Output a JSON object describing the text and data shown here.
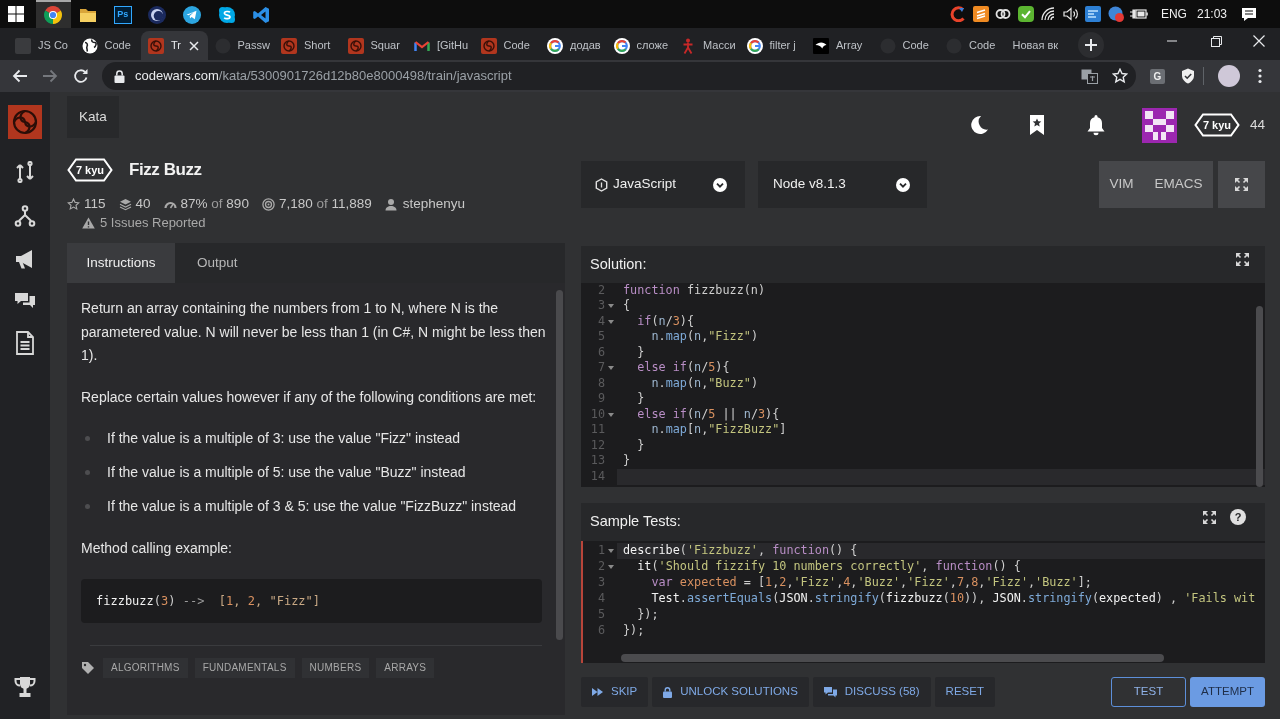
{
  "taskbar": {
    "apps": [
      {
        "kind": "chrome",
        "active": true
      },
      {
        "kind": "folder",
        "active": false
      },
      {
        "kind": "photoshop",
        "label": "Ps",
        "active": false
      },
      {
        "kind": "sphere",
        "active": false
      },
      {
        "kind": "telegram",
        "active": false
      },
      {
        "kind": "skype",
        "active": false
      },
      {
        "kind": "vscode",
        "active": false
      }
    ],
    "tray": [
      {
        "kind": "cleaner"
      },
      {
        "kind": "sublime"
      },
      {
        "kind": "cloud"
      },
      {
        "kind": "check"
      },
      {
        "kind": "wifi"
      },
      {
        "kind": "volume"
      },
      {
        "kind": "window"
      },
      {
        "kind": "badge"
      },
      {
        "kind": "battery"
      }
    ],
    "language": "ENG",
    "time": "21:03"
  },
  "browser_tabs": [
    {
      "title": "JS Co",
      "kind": "tile",
      "selected": false
    },
    {
      "title": "Code",
      "kind": "globe",
      "selected": false
    },
    {
      "title": "Tr",
      "kind": "codewars",
      "selected": true
    },
    {
      "title": "Passw",
      "kind": "github",
      "selected": false
    },
    {
      "title": "Short",
      "kind": "codewars",
      "selected": false
    },
    {
      "title": "Squar",
      "kind": "codewars",
      "selected": false
    },
    {
      "title": "[GitHu",
      "kind": "gmail",
      "selected": false
    },
    {
      "title": "Code",
      "kind": "codewars",
      "selected": false
    },
    {
      "title": "додав",
      "kind": "google",
      "selected": false
    },
    {
      "title": "сложе",
      "kind": "google",
      "selected": false
    },
    {
      "title": "Масси",
      "kind": "figure",
      "selected": false
    },
    {
      "title": "filter j",
      "kind": "google",
      "selected": false
    },
    {
      "title": "Array",
      "kind": "bird",
      "selected": false
    },
    {
      "title": "Code",
      "kind": "github",
      "selected": false
    },
    {
      "title": "Code",
      "kind": "github",
      "selected": false
    },
    {
      "title": "Новая вк",
      "kind": "blank",
      "selected": false
    }
  ],
  "address_bar": {
    "host": "codewars.com",
    "path": "/kata/5300901726d12b80e8000498/train/javascript",
    "extension_label": "G"
  },
  "sidebar": {
    "items": [
      {
        "kind": "logo"
      },
      {
        "kind": "swap"
      },
      {
        "kind": "fork"
      },
      {
        "kind": "megaphone"
      },
      {
        "kind": "chat"
      },
      {
        "kind": "document"
      },
      {
        "kind": "trophy"
      }
    ]
  },
  "header": {
    "tab": "Kata",
    "user_rank": "7 kyu",
    "honor": "44"
  },
  "kata": {
    "rank": "7 kyu",
    "title": "Fizz Buzz",
    "stats": [
      {
        "kind": "stars",
        "value": "115"
      },
      {
        "kind": "collections",
        "value": "40"
      },
      {
        "kind": "satisfaction",
        "value": "87%",
        "of": "of",
        "total": "890"
      },
      {
        "kind": "completions",
        "value": "7,180",
        "of": "of",
        "total": "11,889"
      },
      {
        "kind": "author",
        "value": "stephenyu"
      }
    ],
    "issues": "5 Issues Reported"
  },
  "description_tabs": [
    {
      "label": "Instructions",
      "selected": true
    },
    {
      "label": "Output",
      "selected": false
    }
  ],
  "description": [
    {
      "kind": "paragraph",
      "text": "Return an array containing the numbers from 1 to N, where N is the parametered value. N will never be less than 1 (in C#, N might be less then 1)."
    },
    {
      "kind": "paragraph",
      "text": "Replace certain values however if any of the following conditions are met:"
    },
    {
      "kind": "list",
      "items": [
        "If the value is a multiple of 3: use the value \"Fizz\" instead",
        "If the value is a multiple of 5: use the value \"Buzz\" instead",
        "If the value is a multiple of 3 & 5: use the value \"FizzBuzz\" instead"
      ]
    },
    {
      "kind": "paragraph",
      "text": "Method calling example:"
    },
    {
      "kind": "code",
      "tokens": [
        {
          "kind": "bright",
          "text": "fizzbuzz"
        },
        {
          "kind": "plain",
          "text": "("
        },
        {
          "kind": "num",
          "text": "3"
        },
        {
          "kind": "plain",
          "text": ")"
        },
        {
          "kind": "dim",
          "text": " -->  "
        },
        {
          "kind": "lit",
          "text": "["
        },
        {
          "kind": "num",
          "text": "1"
        },
        {
          "kind": "lit",
          "text": ", "
        },
        {
          "kind": "num",
          "text": "2"
        },
        {
          "kind": "lit",
          "text": ", \"Fizz\"]"
        }
      ]
    }
  ],
  "tags": [
    "ALGORITHMS",
    "FUNDAMENTALS",
    "NUMBERS",
    "ARRAYS"
  ],
  "editor": {
    "language": "JavaScript",
    "version": "Node v8.1.3",
    "modes": [
      {
        "label": "VIM",
        "selected": false
      },
      {
        "label": "EMACS",
        "selected": false
      }
    ]
  },
  "solution": {
    "title": "Solution:",
    "lines": [
      {
        "number": "2",
        "fold": false,
        "active": false,
        "tokens": [
          {
            "kind": "kw",
            "text": "function"
          },
          {
            "kind": "plain",
            "text": " fizzbuzz(n)"
          }
        ]
      },
      {
        "number": "3",
        "fold": true,
        "active": false,
        "tokens": [
          {
            "kind": "plain",
            "text": "{"
          }
        ]
      },
      {
        "number": "4",
        "fold": true,
        "active": false,
        "tokens": [
          {
            "kind": "kw",
            "text": "  if"
          },
          {
            "kind": "plain",
            "text": "("
          },
          {
            "kind": "ident",
            "text": "n"
          },
          {
            "kind": "plain",
            "text": "/"
          },
          {
            "kind": "num",
            "text": "3"
          },
          {
            "kind": "plain",
            "text": "){"
          }
        ]
      },
      {
        "number": "5",
        "fold": false,
        "active": false,
        "tokens": [
          {
            "kind": "ident",
            "text": "    n"
          },
          {
            "kind": "plain",
            "text": "."
          },
          {
            "kind": "fn",
            "text": "map"
          },
          {
            "kind": "plain",
            "text": "("
          },
          {
            "kind": "ident",
            "text": "n"
          },
          {
            "kind": "plain",
            "text": ","
          },
          {
            "kind": "str",
            "text": "\"Fizz\""
          },
          {
            "kind": "plain",
            "text": ")"
          }
        ]
      },
      {
        "number": "6",
        "fold": false,
        "active": false,
        "tokens": [
          {
            "kind": "plain",
            "text": "  }"
          }
        ]
      },
      {
        "number": "7",
        "fold": true,
        "active": false,
        "tokens": [
          {
            "kind": "kw",
            "text": "  else if"
          },
          {
            "kind": "plain",
            "text": "("
          },
          {
            "kind": "ident",
            "text": "n"
          },
          {
            "kind": "plain",
            "text": "/"
          },
          {
            "kind": "num",
            "text": "5"
          },
          {
            "kind": "plain",
            "text": "){"
          }
        ]
      },
      {
        "number": "8",
        "fold": false,
        "active": false,
        "tokens": [
          {
            "kind": "ident",
            "text": "    n"
          },
          {
            "kind": "plain",
            "text": "."
          },
          {
            "kind": "fn",
            "text": "map"
          },
          {
            "kind": "plain",
            "text": "("
          },
          {
            "kind": "ident",
            "text": "n"
          },
          {
            "kind": "plain",
            "text": ","
          },
          {
            "kind": "str",
            "text": "\"Buzz\""
          },
          {
            "kind": "plain",
            "text": ")"
          }
        ]
      },
      {
        "number": "9",
        "fold": false,
        "active": false,
        "tokens": [
          {
            "kind": "plain",
            "text": "  }"
          }
        ]
      },
      {
        "number": "10",
        "fold": true,
        "active": false,
        "tokens": [
          {
            "kind": "kw",
            "text": "  else if"
          },
          {
            "kind": "plain",
            "text": "("
          },
          {
            "kind": "ident",
            "text": "n"
          },
          {
            "kind": "plain",
            "text": "/"
          },
          {
            "kind": "num",
            "text": "5"
          },
          {
            "kind": "plain",
            "text": " || "
          },
          {
            "kind": "ident",
            "text": "n"
          },
          {
            "kind": "plain",
            "text": "/"
          },
          {
            "kind": "num",
            "text": "3"
          },
          {
            "kind": "plain",
            "text": "){"
          }
        ]
      },
      {
        "number": "11",
        "fold": false,
        "active": false,
        "tokens": [
          {
            "kind": "ident",
            "text": "    n"
          },
          {
            "kind": "plain",
            "text": "."
          },
          {
            "kind": "fn",
            "text": "map"
          },
          {
            "kind": "plain",
            "text": "["
          },
          {
            "kind": "ident",
            "text": "n"
          },
          {
            "kind": "plain",
            "text": ","
          },
          {
            "kind": "str",
            "text": "\"FizzBuzz\""
          },
          {
            "kind": "plain",
            "text": "]"
          }
        ]
      },
      {
        "number": "12",
        "fold": false,
        "active": false,
        "tokens": [
          {
            "kind": "plain",
            "text": "  }"
          }
        ]
      },
      {
        "number": "13",
        "fold": false,
        "active": false,
        "tokens": [
          {
            "kind": "plain",
            "text": "}"
          }
        ]
      },
      {
        "number": "14",
        "fold": false,
        "active": true
      }
    ]
  },
  "sample_tests": {
    "title": "Sample Tests:",
    "help": "?",
    "lines": [
      {
        "number": "1",
        "fold": true,
        "active": true,
        "tokens": [
          {
            "kind": "bright",
            "text": "describe"
          },
          {
            "kind": "plain",
            "text": "("
          },
          {
            "kind": "str",
            "text": "'Fizzbuzz'"
          },
          {
            "kind": "plain",
            "text": ", "
          },
          {
            "kind": "kw",
            "text": "function"
          },
          {
            "kind": "plain",
            "text": "() {"
          }
        ]
      },
      {
        "number": "2",
        "fold": true,
        "active": false,
        "tokens": [
          {
            "kind": "bright",
            "text": "  it"
          },
          {
            "kind": "plain",
            "text": "("
          },
          {
            "kind": "str",
            "text": "'Should fizzify 10 numbers correctly'"
          },
          {
            "kind": "plain",
            "text": ", "
          },
          {
            "kind": "kw",
            "text": "function"
          },
          {
            "kind": "plain",
            "text": "() {"
          }
        ]
      },
      {
        "number": "3",
        "fold": false,
        "active": false,
        "tokens": [
          {
            "kind": "kw",
            "text": "    var "
          },
          {
            "kind": "var",
            "text": "expected"
          },
          {
            "kind": "plain",
            "text": " = ["
          },
          {
            "kind": "num",
            "text": "1"
          },
          {
            "kind": "plain",
            "text": ","
          },
          {
            "kind": "num",
            "text": "2"
          },
          {
            "kind": "plain",
            "text": ","
          },
          {
            "kind": "str",
            "text": "'Fizz'"
          },
          {
            "kind": "plain",
            "text": ","
          },
          {
            "kind": "num",
            "text": "4"
          },
          {
            "kind": "plain",
            "text": ","
          },
          {
            "kind": "str",
            "text": "'Buzz'"
          },
          {
            "kind": "plain",
            "text": ","
          },
          {
            "kind": "str",
            "text": "'Fizz'"
          },
          {
            "kind": "plain",
            "text": ","
          },
          {
            "kind": "num",
            "text": "7"
          },
          {
            "kind": "plain",
            "text": ","
          },
          {
            "kind": "num",
            "text": "8"
          },
          {
            "kind": "plain",
            "text": ","
          },
          {
            "kind": "str",
            "text": "'Fizz'"
          },
          {
            "kind": "plain",
            "text": ","
          },
          {
            "kind": "str",
            "text": "'Buzz'"
          },
          {
            "kind": "plain",
            "text": "];"
          }
        ]
      },
      {
        "number": "4",
        "fold": false,
        "active": false,
        "tokens": [
          {
            "kind": "bright",
            "text": "    Test"
          },
          {
            "kind": "plain",
            "text": "."
          },
          {
            "kind": "fn",
            "text": "assertEquals"
          },
          {
            "kind": "plain",
            "text": "("
          },
          {
            "kind": "bright",
            "text": "JSON"
          },
          {
            "kind": "plain",
            "text": "."
          },
          {
            "kind": "fn",
            "text": "stringify"
          },
          {
            "kind": "plain",
            "text": "("
          },
          {
            "kind": "bright",
            "text": "fizzbuzz"
          },
          {
            "kind": "plain",
            "text": "("
          },
          {
            "kind": "num",
            "text": "10"
          },
          {
            "kind": "plain",
            "text": ")), "
          },
          {
            "kind": "bright",
            "text": "JSON"
          },
          {
            "kind": "plain",
            "text": "."
          },
          {
            "kind": "fn",
            "text": "stringify"
          },
          {
            "kind": "plain",
            "text": "("
          },
          {
            "kind": "bright",
            "text": "expected"
          },
          {
            "kind": "plain",
            "text": ") , "
          },
          {
            "kind": "str",
            "text": "'Fails wit"
          }
        ]
      },
      {
        "number": "5",
        "fold": false,
        "active": false,
        "tokens": [
          {
            "kind": "plain",
            "text": "  });"
          }
        ]
      },
      {
        "number": "6",
        "fold": false,
        "active": false,
        "tokens": [
          {
            "kind": "plain",
            "text": "});"
          }
        ]
      }
    ]
  },
  "actions": [
    {
      "kind": "skip",
      "label": "SKIP"
    },
    {
      "kind": "unlock",
      "label": "UNLOCK SOLUTIONS"
    },
    {
      "kind": "discuss",
      "label": "DISCUSS (58)"
    },
    {
      "kind": "reset",
      "label": "RESET"
    }
  ],
  "submit": [
    {
      "kind": "outline",
      "label": "TEST"
    },
    {
      "kind": "primary",
      "label": "ATTEMPT"
    }
  ]
}
